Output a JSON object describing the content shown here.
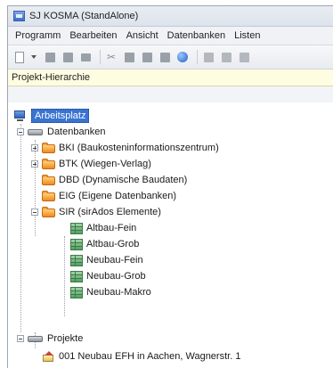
{
  "window": {
    "title": "SJ KOSMA (StandAlone)"
  },
  "menu": [
    "Programm",
    "Bearbeiten",
    "Ansicht",
    "Datenbanken",
    "Listen"
  ],
  "panel": {
    "header": "Projekt-Hierarchie"
  },
  "tree": {
    "root": "Arbeitsplatz",
    "databases": {
      "label": "Datenbanken",
      "items": [
        "BKI (Baukosteninformationszentrum)",
        "BTK (Wiegen-Verlag)",
        "DBD (Dynamische Baudaten)",
        "EIG (Eigene Datenbanken)",
        "SIR (sirAdos Elemente)"
      ],
      "sir_children": [
        "Altbau-Fein",
        "Altbau-Grob",
        "Neubau-Fein",
        "Neubau-Grob",
        "Neubau-Makro"
      ]
    },
    "projects": {
      "label": "Projekte",
      "items": [
        "001 Neubau EFH in Aachen, Wagnerstr. 1"
      ]
    }
  },
  "icons": {
    "app": "app-icon",
    "toolbar": [
      "new-document-icon",
      "dropdown-arrow-icon",
      "toolbar-icon",
      "toolbar-icon",
      "print-icon",
      "cut-icon",
      "copy-icon",
      "paste-icon",
      "toolbar-icon",
      "globe-icon",
      "toolbar-icon",
      "toolbar-icon",
      "toolbar-icon"
    ]
  },
  "colors": {
    "selection": "#3a74d1",
    "panel_header": "#fffde1",
    "db_icon": "#f08a1c",
    "table_icon": "#4fa060"
  }
}
